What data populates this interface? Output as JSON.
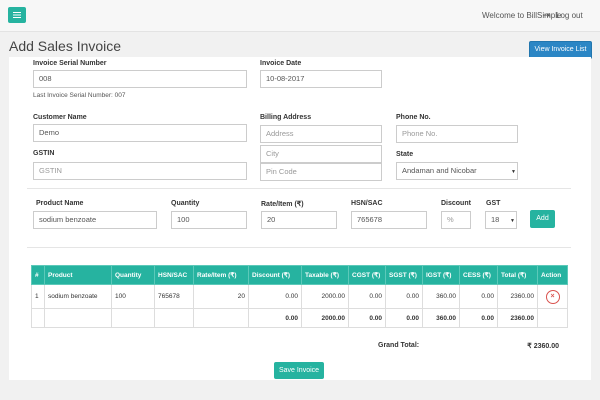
{
  "header": {
    "welcome_text": "Welcome to BillSimple",
    "logout_label": "Log out"
  },
  "page": {
    "title": "Add Sales Invoice",
    "view_list_label": "View Invoice List"
  },
  "form": {
    "serial": {
      "label": "Invoice Serial Number",
      "value": "008",
      "last_note": "Last Invoice Serial Number: 007"
    },
    "date": {
      "label": "Invoice Date",
      "value": "10-08-2017"
    },
    "customer": {
      "label": "Customer Name",
      "value": "Demo"
    },
    "billing": {
      "label": "Billing Address",
      "address_placeholder": "Address",
      "city_placeholder": "City",
      "pin_placeholder": "Pin Code"
    },
    "phone": {
      "label": "Phone No.",
      "placeholder": "Phone No."
    },
    "gstin": {
      "label": "GSTIN",
      "placeholder": "GSTIN"
    },
    "state": {
      "label": "State",
      "value": "Andaman and Nicobar"
    }
  },
  "item_entry": {
    "product": {
      "label": "Product Name",
      "value": "sodium benzoate"
    },
    "quantity": {
      "label": "Quantity",
      "value": "100"
    },
    "rate": {
      "label": "Rate/Item (₹)",
      "value": "20"
    },
    "hsn": {
      "label": "HSN/SAC",
      "value": "765678"
    },
    "discount": {
      "label": "Discount",
      "placeholder": "%"
    },
    "gst": {
      "label": "GST",
      "value": "18"
    },
    "add_label": "Add"
  },
  "table": {
    "headers": [
      "#",
      "Product",
      "Quantity",
      "HSN/SAC",
      "Rate/Item (₹)",
      "Discount (₹)",
      "Taxable (₹)",
      "CGST (₹)",
      "SGST (₹)",
      "IGST (₹)",
      "CESS (₹)",
      "Total (₹)",
      "Action"
    ],
    "rows": [
      {
        "num": "1",
        "product": "sodium benzoate",
        "quantity": "100",
        "hsn": "765678",
        "rate": "20",
        "discount": "0.00",
        "taxable": "2000.00",
        "cgst": "0.00",
        "sgst": "0.00",
        "igst": "360.00",
        "cess": "0.00",
        "total": "2360.00",
        "action_icon": "close-icon"
      }
    ],
    "totals": {
      "discount": "0.00",
      "taxable": "2000.00",
      "cgst": "0.00",
      "sgst": "0.00",
      "igst": "360.00",
      "cess": "0.00",
      "total": "2360.00"
    }
  },
  "summary": {
    "grand_total_label": "Grand Total:",
    "grand_total_value": "₹ 2360.00"
  },
  "save_label": "Save Invoice",
  "colors": {
    "teal": "#26b3a0",
    "blue": "#2b86c5",
    "danger": "#d9534f"
  }
}
